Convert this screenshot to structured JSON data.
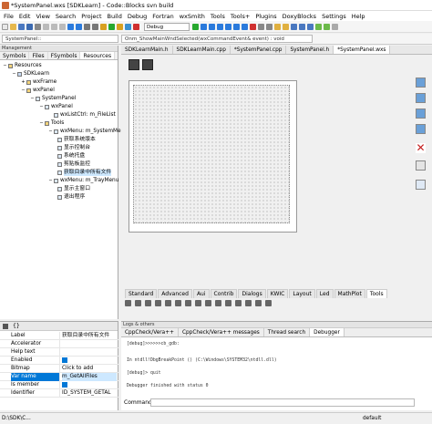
{
  "window": {
    "title": "*SystemPanel.wxs [SDKLearn] - Code::Blocks svn build"
  },
  "menu": [
    "File",
    "Edit",
    "View",
    "Search",
    "Project",
    "Build",
    "Debug",
    "Fortran",
    "wxSmith",
    "Tools",
    "Tools+",
    "Plugins",
    "DoxyBlocks",
    "Settings",
    "Help"
  ],
  "toolbar": {
    "build_target": "Debug"
  },
  "scope": {
    "class": "SystemPanel::",
    "function": "Onm_ShowMainWndSelected(wxCommandEvent& event) : void"
  },
  "management": {
    "header": "Management",
    "tabs": [
      "Symbols",
      "Files",
      "FSymbols",
      "Resources"
    ],
    "active_tab": "Resources",
    "tree": [
      {
        "label": "Resources",
        "icon": "folder-icon"
      },
      {
        "label": "SDKLearn",
        "icon": "project-icon"
      },
      {
        "label": "wxFrame",
        "icon": "folder-icon"
      },
      {
        "label": "wxPanel",
        "icon": "folder-icon"
      },
      {
        "label": "SystemPanel",
        "icon": "panel-icon"
      },
      {
        "label": "wxPanel",
        "icon": "panel-icon"
      },
      {
        "label": "wxListCtrl: m_FileList",
        "icon": "list-icon"
      },
      {
        "label": "Tools",
        "icon": "folder-icon"
      },
      {
        "label": "wxMenu: m_SystemMenu",
        "icon": "menu-icon"
      },
      {
        "label": "获取系统版本",
        "icon": "menu-item-icon"
      },
      {
        "label": "显示控制台",
        "icon": "menu-item-icon"
      },
      {
        "label": "系统托盘",
        "icon": "menu-item-icon"
      },
      {
        "label": "剪贴板监控",
        "icon": "menu-item-icon"
      },
      {
        "label": "获取目录中所有文件",
        "icon": "menu-item-icon"
      },
      {
        "label": "wxMenu: m_TrayMenu",
        "icon": "menu-icon"
      },
      {
        "label": "显示主窗口",
        "icon": "menu-item-icon"
      },
      {
        "label": "退出程序",
        "icon": "menu-item-icon"
      }
    ]
  },
  "properties": {
    "rows": [
      {
        "key": "Label",
        "value": "获取目录中所有文件"
      },
      {
        "key": "Accelerator",
        "value": ""
      },
      {
        "key": "Help text",
        "value": ""
      },
      {
        "key": "Enabled",
        "value": "",
        "checkbox": true
      },
      {
        "key": "Bitmap",
        "value": "Click to add"
      },
      {
        "key": "Var name",
        "value": "m_GetAllFiles",
        "selected": true
      },
      {
        "key": "Is member",
        "value": "",
        "checkbox": true
      },
      {
        "key": "Identifier",
        "value": "ID_SYSTEM_GETAL"
      }
    ]
  },
  "editor": {
    "tabs": [
      "SDKLearnMain.h",
      "SDKLearnMain.cpp",
      "*SystemPanel.cpp",
      "SystemPanel.h",
      "*SystemPanel.wxs"
    ],
    "active_tab": "*SystemPanel.wxs",
    "palette_tabs": [
      "Standard",
      "Advanced",
      "Aui",
      "Contrib",
      "Dialogs",
      "KWIC",
      "Layout",
      "Led",
      "MathPlot",
      "Tools"
    ],
    "active_palette_tab": "Tools"
  },
  "logs": {
    "header": "Logs & others",
    "tabs": [
      "CppCheck/Vera++",
      "CppCheck/Vera++ messages",
      "Thread search",
      "Debugger"
    ],
    "active_tab": "Debugger",
    "lines": [
      "[debug]>>>>>>cb_gdb:",
      "In ntdll!DbgBreakPoint () (C:\\Windows\\SYSTEM32\\ntdll.dll)",
      "[debug]> quit",
      "Debugger finished with status 0"
    ],
    "command_label": "Command:"
  },
  "status": {
    "path": "D:\\SDK\\C...",
    "encoding": "default"
  }
}
